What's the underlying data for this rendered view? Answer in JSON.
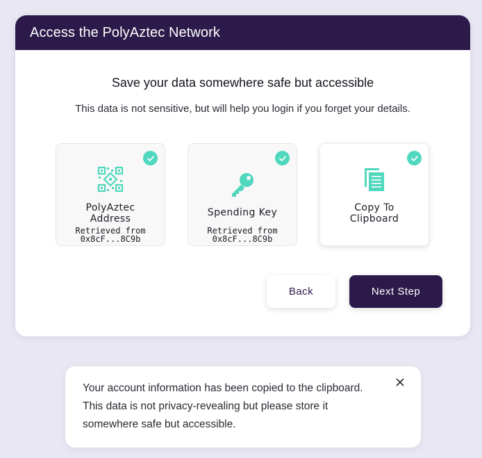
{
  "modal": {
    "title": "Access the PolyAztec Network",
    "heading": "Save your data somewhere safe but accessible",
    "subtext": "This data is not sensitive, but will help you login if you forget your details."
  },
  "cards": [
    {
      "icon": "qr-code-icon",
      "title_line1": "PolyAztec",
      "title_line2": "Address",
      "sub_line1": "Retrieved from",
      "sub_line2": "0x8cF...8C9b",
      "checked": true
    },
    {
      "icon": "key-icon",
      "title_line1": "Spending Key",
      "sub_line1": "Retrieved from",
      "sub_line2": "0x8cF...8C9b",
      "checked": true
    },
    {
      "icon": "copy-icon",
      "title_line1": "Copy To",
      "title_line2": "Clipboard",
      "checked": true
    }
  ],
  "buttons": {
    "back_label": "Back",
    "next_label": "Next Step"
  },
  "toast": {
    "line1": "Your account information has been copied to the clipboard.",
    "line2": "This data is not privacy-revealing but please store it",
    "line3": "somewhere safe but accessible."
  },
  "colors": {
    "header_bg": "#2c1b4a",
    "accent": "#4fd8bd",
    "page_bg": "#e9e8f2"
  }
}
